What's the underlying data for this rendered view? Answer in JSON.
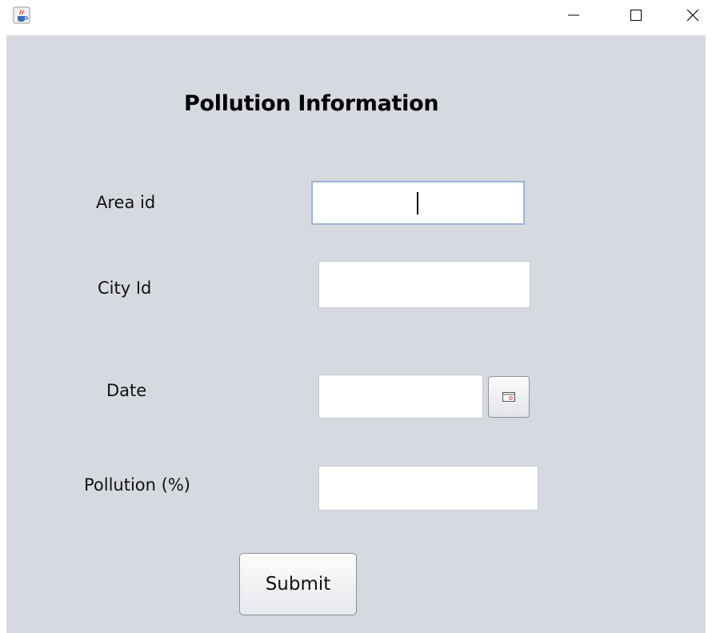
{
  "window": {
    "app_icon": "java-coffee-icon",
    "controls": {
      "minimize_icon": "minimize-icon",
      "maximize_icon": "maximize-icon",
      "close_icon": "close-icon"
    }
  },
  "form": {
    "title": "Pollution Information",
    "fields": {
      "area_id": {
        "label": "Area id",
        "value": ""
      },
      "city_id": {
        "label": "City Id",
        "value": ""
      },
      "date": {
        "label": "Date",
        "value": "",
        "picker_icon": "calendar-icon"
      },
      "pollution": {
        "label": "Pollution (%)",
        "value": ""
      }
    },
    "submit_label": "Submit"
  },
  "colors": {
    "panel_background": "#d7d9e1",
    "focus_border": "#9db3d3",
    "field_background": "#ffffff"
  }
}
